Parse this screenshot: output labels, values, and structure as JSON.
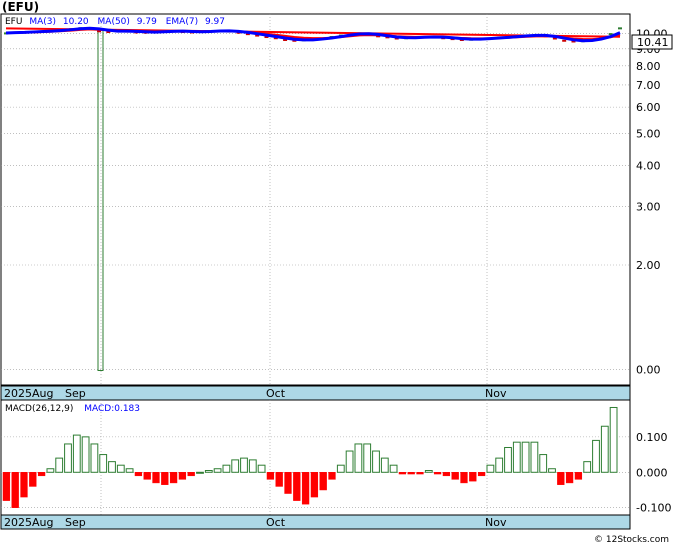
{
  "header": {
    "ticker_title": "(EFU)",
    "legend": {
      "symbol": "EFU",
      "ma3_label": "MA(3)",
      "ma3_value": "10.20",
      "ma50_label": "MA(50)",
      "ma50_value": "9.79",
      "ema7_label": "EMA(7)",
      "ema7_value": "9.97"
    },
    "last_price_tag": "10.41"
  },
  "macd_legend": {
    "label": "MACD(26,12,9)",
    "value_label": "MACD:0.183"
  },
  "watermark": "© 12Stocks.com",
  "colors": {
    "ma3": "#0000ff",
    "ma50": "#ff0000",
    "ema7": "#ff0000",
    "candle_up": "#2e7d32",
    "candle_down": "#cc0000",
    "macd_neg_fill": "#ff0000",
    "macd_pos_stroke": "#2e7d32",
    "axis_band": "#add8e6",
    "grid": "#999999"
  },
  "chart_data": [
    {
      "type": "line",
      "title": "(EFU)",
      "y_scale": "log",
      "ylim": [
        0.88,
        11.0
      ],
      "y_ticks": [
        10.0,
        9.0,
        8.0,
        7.0,
        6.0,
        5.0,
        4.0,
        3.0,
        2.0,
        0.0
      ],
      "y_tick_labels": [
        "10.00",
        "9.00",
        "8.00",
        "7.00",
        "6.00",
        "5.00",
        "4.00",
        "3.00",
        "2.00",
        "0.00"
      ],
      "x_labels": [
        {
          "label": "2025Aug",
          "day": 0
        },
        {
          "label": "Sep",
          "day": 8
        },
        {
          "label": "Oct",
          "day": 30
        },
        {
          "label": "Nov",
          "day": 53
        }
      ],
      "n_days": 67,
      "grid": true,
      "series": [
        {
          "name": "EFU",
          "kind": "price",
          "values": [
            10.05,
            10.1,
            10.12,
            10.15,
            10.18,
            10.22,
            10.28,
            10.35,
            10.42,
            10.4,
            10.2,
            10.15,
            10.2,
            10.18,
            10.12,
            10.1,
            10.12,
            10.18,
            10.2,
            10.15,
            10.12,
            10.15,
            10.2,
            10.22,
            10.18,
            10.1,
            10.0,
            9.9,
            9.8,
            9.72,
            9.6,
            9.55,
            9.58,
            9.62,
            9.7,
            9.8,
            9.9,
            10.0,
            10.05,
            9.95,
            9.85,
            9.78,
            9.7,
            9.72,
            9.75,
            9.8,
            9.78,
            9.72,
            9.66,
            9.6,
            9.62,
            9.66,
            9.7,
            9.75,
            9.8,
            9.85,
            9.9,
            9.9,
            9.85,
            9.7,
            9.55,
            9.5,
            9.52,
            9.6,
            9.8,
            10.0,
            10.41
          ]
        },
        {
          "name": "MA(3)",
          "kind": "ma3"
        },
        {
          "name": "MA(50)",
          "kind": "ma50"
        },
        {
          "name": "EMA(7)",
          "kind": "ema7"
        }
      ],
      "spike": {
        "day": 10,
        "low": 0.96,
        "high": 10.25
      }
    },
    {
      "type": "bar",
      "title": "MACD(26,12,9)",
      "ylim": [
        -0.115,
        0.19
      ],
      "y_ticks": [
        0.1,
        0.0,
        -0.1
      ],
      "y_tick_labels": [
        "0.100",
        "0.000",
        "-0.100"
      ],
      "grid": true,
      "histogram": [
        -0.08,
        -0.1,
        -0.07,
        -0.04,
        -0.01,
        0.01,
        0.04,
        0.08,
        0.105,
        0.1,
        0.08,
        0.05,
        0.03,
        0.02,
        0.01,
        -0.01,
        -0.02,
        -0.03,
        -0.035,
        -0.03,
        -0.02,
        -0.01,
        0.0,
        0.005,
        0.01,
        0.02,
        0.035,
        0.04,
        0.035,
        0.02,
        -0.02,
        -0.04,
        -0.06,
        -0.08,
        -0.09,
        -0.07,
        -0.05,
        -0.02,
        0.02,
        0.06,
        0.08,
        0.08,
        0.06,
        0.04,
        0.02,
        -0.005,
        -0.005,
        -0.005,
        0.005,
        -0.005,
        -0.01,
        -0.02,
        -0.03,
        -0.025,
        -0.01,
        0.02,
        0.04,
        0.07,
        0.085,
        0.085,
        0.085,
        0.05,
        0.01,
        -0.035,
        -0.03,
        -0.02,
        0.03,
        0.09,
        0.13,
        0.183
      ]
    }
  ]
}
